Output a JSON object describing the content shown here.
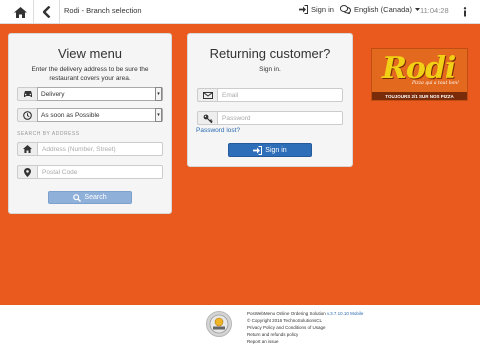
{
  "topbar": {
    "title": "Rodi - Branch selection",
    "signin_label": "Sign in",
    "language_label": "English (Canada)",
    "time": "11:04:28"
  },
  "view_menu": {
    "title": "View menu",
    "description": "Enter the delivery address to be sure the restaurant covers your area.",
    "order_type": "Delivery",
    "timing": "As soon as Possible",
    "section_label": "SEARCH BY ADDRESS",
    "address_placeholder": "Address (Number, Street)",
    "postal_placeholder": "Postal Code",
    "search_label": "Search"
  },
  "returning": {
    "title": "Returning customer?",
    "subtitle": "Sign in.",
    "email_placeholder": "Email",
    "password_placeholder": "Password",
    "forgot_label": "Password lost?",
    "signin_label": "Sign in"
  },
  "logo": {
    "word": "Rodi",
    "tagline": "Pizza qui a tout bon!",
    "promo": "TOUJOURS 2/1 SUR NOS PIZZA"
  },
  "footer": {
    "product": "PosWebMenu Online Ordering Solution",
    "version": "v.3.7.10.10 Mobile",
    "copyright": "© Copyright 2016 TechnoSolutionsCL",
    "privacy": "Privacy Policy and Conditions of Usage",
    "refund": "Return and refunds policy",
    "report": "Report an issue"
  },
  "colors": {
    "band": "#ea5a1e",
    "primary_button": "#2e6eb8",
    "link": "#2a6ab0"
  }
}
